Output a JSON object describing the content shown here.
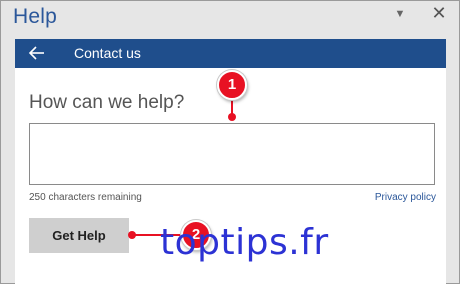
{
  "pane": {
    "title": "Help",
    "menu_glyph": "▼",
    "close_glyph": "✕"
  },
  "nav": {
    "back_icon": "arrow-left",
    "title": "Contact us"
  },
  "form": {
    "heading": "How can we help?",
    "textarea_value": "",
    "chars_remaining": "250 characters remaining",
    "privacy_link": "Privacy policy",
    "submit_label": "Get Help"
  },
  "callouts": [
    {
      "number": "1"
    },
    {
      "number": "2"
    }
  ],
  "watermark": "toptips.fr",
  "colors": {
    "accent": "#2b579a",
    "navbar": "#1f4e8c",
    "callout": "#e81123",
    "watermark": "#2c32d4"
  }
}
